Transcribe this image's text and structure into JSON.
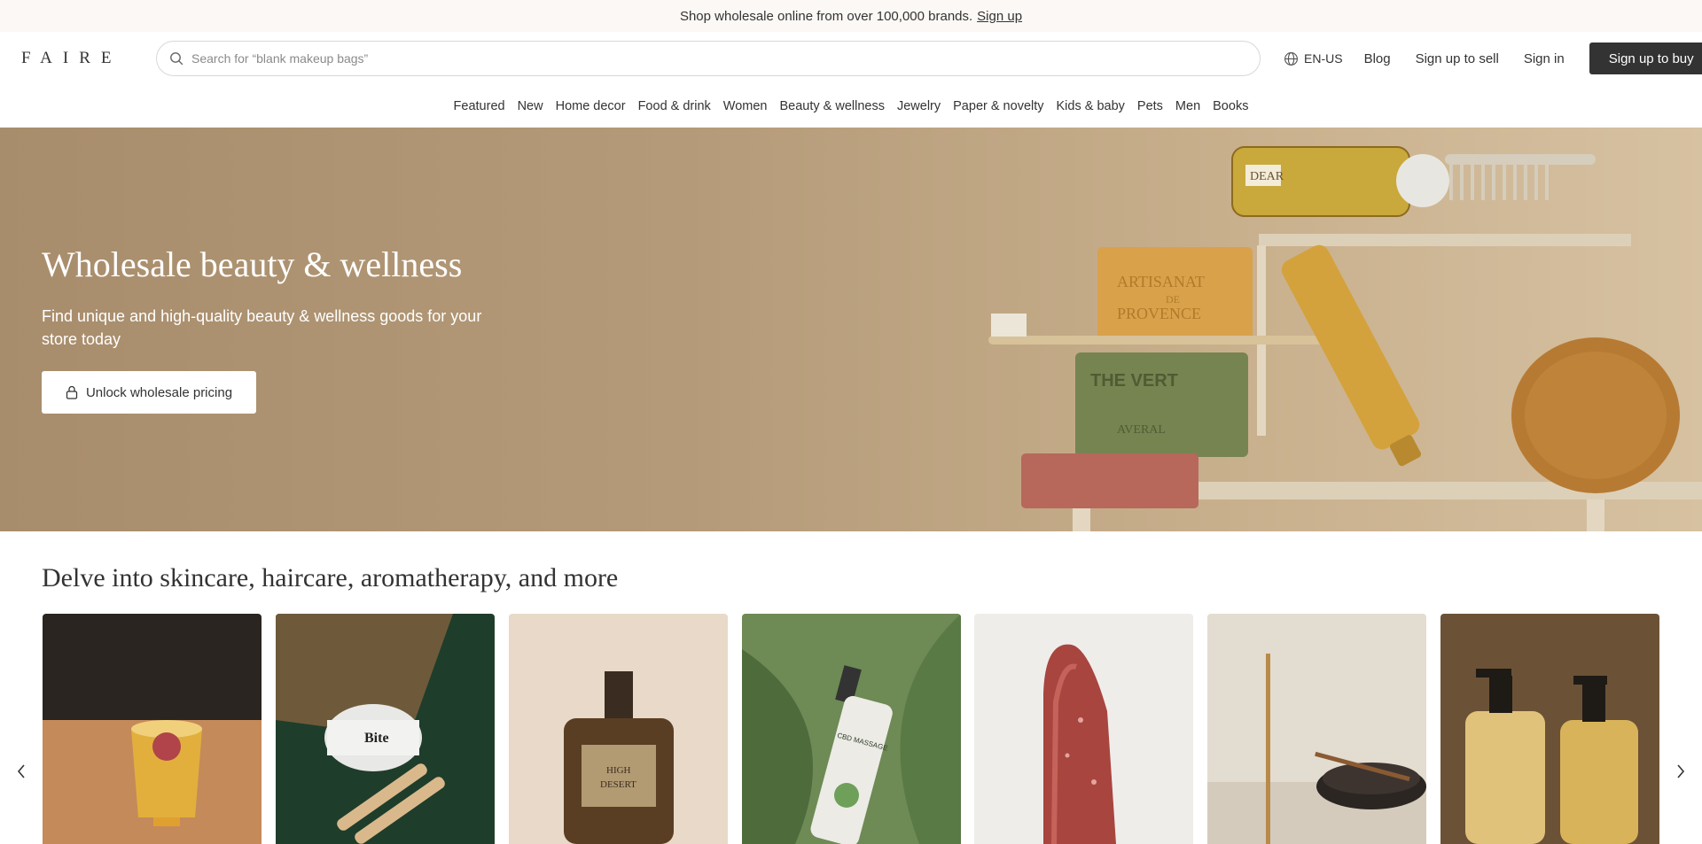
{
  "promo": {
    "text": "Shop wholesale online from over 100,000 brands.",
    "link": "Sign up"
  },
  "header": {
    "logo": "FAIRE",
    "search_placeholder": "Search for “blank makeup bags”",
    "language": "EN-US",
    "blog": "Blog",
    "sign_up_to_sell": "Sign up to sell",
    "sign_in": "Sign in",
    "sign_up_to_buy": "Sign up to buy"
  },
  "nav": {
    "items": [
      "Featured",
      "New",
      "Home decor",
      "Food & drink",
      "Women",
      "Beauty & wellness",
      "Jewelry",
      "Paper & novelty",
      "Kids & baby",
      "Pets",
      "Men",
      "Books"
    ]
  },
  "hero": {
    "title": "Wholesale beauty & wellness",
    "subtitle": "Find unique and high-quality beauty & wellness goods for your store today",
    "button": "Unlock wholesale pricing",
    "image_labels": {
      "bottle": "DEAR",
      "soap1_line1": "ARTISANAT",
      "soap1_line2": "DE",
      "soap1_line3": "PROVENCE",
      "soap2_line1": "THE VERT",
      "soap2_line2": "AVERAL"
    }
  },
  "section": {
    "title": "Delve into skincare, haircare, aromatherapy, and more",
    "cards": [
      {
        "image": "glass-drink-photo"
      },
      {
        "image": "bite-toothpaste-photo",
        "label": "Bite"
      },
      {
        "image": "perfume-bottle-photo",
        "label_line1": "HIGH",
        "label_line2": "DESERT"
      },
      {
        "image": "massage-oil-photo",
        "label": "CBD MASSAGE"
      },
      {
        "image": "lipstick-photo"
      },
      {
        "image": "incense-photo"
      },
      {
        "image": "soap-dispenser-photo"
      }
    ]
  },
  "icons": {
    "search": "search-icon",
    "globe": "globe-icon",
    "lock": "lock-icon",
    "prev": "chevron-left-icon",
    "next": "chevron-right-icon"
  },
  "colors": {
    "dark": "#333333",
    "banner_bg": "#fbf8f5",
    "hero_bg": "#b49a78"
  }
}
